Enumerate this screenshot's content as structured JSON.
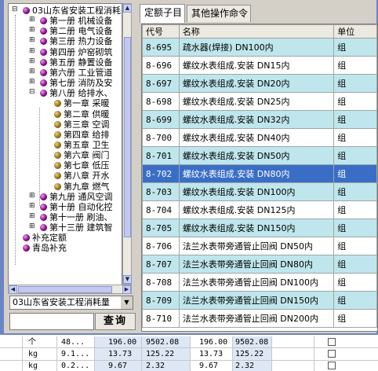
{
  "tree": {
    "root_label": "03山东省安装工程消耗",
    "books": [
      "第一册 机械设备",
      "第二册 电气设备",
      "第三册 热力设备",
      "第四册 炉窑砌筑",
      "第五册 静置设备",
      "第六册 工业管道",
      "第七册 消防及安",
      "第八册 给排水、"
    ],
    "chapters": [
      "第一章 采暖",
      "第二章 供暖",
      "第三章 空调",
      "第四章 给排",
      "第五章 卫生",
      "第六章 阀门",
      "第七章 低压",
      "第八章 开水",
      "第九章 燃气"
    ],
    "books_after": [
      "第九册 通风空调",
      "第十册 自动化控",
      "第十一册 刷油、",
      "第十三册 建筑智"
    ],
    "extra": [
      "补充定额",
      "青岛补充"
    ]
  },
  "combo": {
    "value": "03山东省安装工程消耗量"
  },
  "search": {
    "label": "查询",
    "value": ""
  },
  "tabs": [
    {
      "label": "定额子目"
    },
    {
      "label": "其他操作命令"
    }
  ],
  "grid": {
    "headers": [
      "代号",
      "名称",
      "单位"
    ],
    "rows": [
      {
        "code": "8-695",
        "name": "疏水器(焊接) DN100内",
        "unit": "组"
      },
      {
        "code": "8-696",
        "name": "螺纹水表组成.安装 DN15内",
        "unit": "组"
      },
      {
        "code": "8-697",
        "name": "螺纹水表组成.安装 DN20内",
        "unit": "组"
      },
      {
        "code": "8-698",
        "name": "螺纹水表组成.安装 DN25内",
        "unit": "组"
      },
      {
        "code": "8-699",
        "name": "螺纹水表组成.安装 DN32内",
        "unit": "组"
      },
      {
        "code": "8-700",
        "name": "螺纹水表组成.安装 DN40内",
        "unit": "组"
      },
      {
        "code": "8-701",
        "name": "螺纹水表组成.安装 DN50内",
        "unit": "组"
      },
      {
        "code": "8-702",
        "name": "螺纹水表组成.安装 DN80内",
        "unit": "组"
      },
      {
        "code": "8-703",
        "name": "螺纹水表组成.安装 DN100内",
        "unit": "组"
      },
      {
        "code": "8-704",
        "name": "螺纹水表组成.安装 DN125内",
        "unit": "组"
      },
      {
        "code": "8-705",
        "name": "螺纹水表组成.安装 DN150内",
        "unit": "组"
      },
      {
        "code": "8-706",
        "name": "法兰水表带旁通管止回阀 DN50内",
        "unit": "组"
      },
      {
        "code": "8-707",
        "name": "法兰水表带旁通管止回阀 DN80内",
        "unit": "组"
      },
      {
        "code": "8-708",
        "name": "法兰水表带旁通管止回阀 DN100内",
        "unit": "组"
      },
      {
        "code": "8-709",
        "name": "法兰水表带旁通管止回阀 DN150内",
        "unit": "组"
      },
      {
        "code": "8-710",
        "name": "法兰水表带旁通管止回阀 DN200内",
        "unit": "组"
      }
    ]
  },
  "background_sheet": {
    "rows": [
      {
        "c1": "个",
        "c2": "48...",
        "c3": "196.00",
        "c4": "9502.08",
        "c5": "196.00",
        "c6": "9502.08"
      },
      {
        "c1": "kg",
        "c2": "9.1...",
        "c3": "13.73",
        "c4": "125.22",
        "c5": "13.73",
        "c6": "125.22"
      },
      {
        "c1": "kg",
        "c2": "0.2...",
        "c3": "9.67",
        "c4": "2.32",
        "c5": "9.67",
        "c6": "2.32"
      }
    ]
  },
  "colors": {
    "selected_row": "#3a6ec6",
    "alt_row": "#bfe6ec",
    "frame": "#6b84c6"
  }
}
